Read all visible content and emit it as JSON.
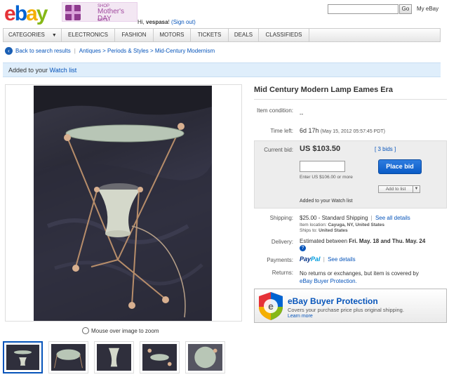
{
  "header": {
    "logo": {
      "e": "e",
      "b": "b",
      "a": "a",
      "y": "y"
    },
    "promo": {
      "line1": "SHOP",
      "line2": "Mother's DAY",
      "line3": "GIFTS ›"
    },
    "greeting_prefix": "Hi, ",
    "username": "vespasa",
    "greeting_suffix": "! ",
    "sign_out": "(Sign out)",
    "search_value": "",
    "go_label": "Go",
    "my_ebay": "My eBay"
  },
  "nav": {
    "items": [
      "CATEGORIES",
      "ELECTRONICS",
      "FASHION",
      "MOTORS",
      "TICKETS",
      "DEALS",
      "CLASSIFIEDS"
    ],
    "caret": "▼"
  },
  "breadcrumb": {
    "back": "Back to search results",
    "sep": "|",
    "path": "Antiques > Periods & Styles > Mid-Century Modernism"
  },
  "banner": {
    "prefix": "Added to your ",
    "link": "Watch list"
  },
  "gallery": {
    "zoom_text": "Mouse over image to zoom",
    "thumbnail_count": 5
  },
  "item": {
    "title": "Mid Century Modern Lamp Eames Era",
    "condition_label": "Item condition:",
    "condition_value": "--",
    "time_left_label": "Time left:",
    "time_left_value": "6d 17h",
    "time_left_detail": "(May 15, 2012 05:57:45 PDT)",
    "current_bid_label": "Current bid:",
    "current_bid_value": "US $103.50",
    "bids": "[ 3 bids ]",
    "bid_input_value": "",
    "enter_hint": "Enter US $106.00 or more",
    "place_bid": "Place bid",
    "add_to_list": "Add to list",
    "add_to_list_caret": "▼",
    "added_watch": "Added to your Watch list",
    "shipping_label": "Shipping:",
    "shipping_value": "$25.00",
    "shipping_method": " - Standard Shipping",
    "shipping_sep": "|",
    "shipping_details": "See all details",
    "item_location_label": "Item location: ",
    "item_location": "Cayuga, NY, United States",
    "ships_to_label": "Ships to: ",
    "ships_to": "United States",
    "delivery_label": "Delivery:",
    "delivery_prefix": "Estimated between ",
    "delivery_value": "Fri. May. 18 and Thu. May. 24",
    "payments_label": "Payments:",
    "paypal_1": "Pay",
    "paypal_2": "Pal",
    "payments_sep": "|",
    "payments_details": "See details",
    "returns_label": "Returns:",
    "returns_value": "No returns or exchanges, but item is covered by",
    "returns_link": "eBay Buyer Protection."
  },
  "protection": {
    "title": "eBay Buyer Protection",
    "subtitle": "Covers your purchase price plus original shipping.",
    "learn_more": "Learn more"
  },
  "colors": {
    "link": "#0654ba",
    "banner": "#dfeefb",
    "place_bid": "#0a5bc6"
  }
}
